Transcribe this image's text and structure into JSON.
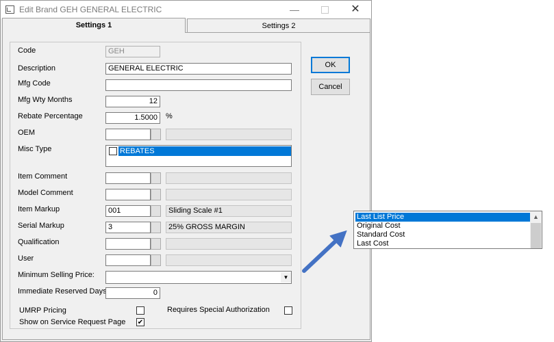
{
  "window": {
    "title": "Edit Brand GEH GENERAL ELECTRIC",
    "min_glyph": "—",
    "close_glyph": "✕"
  },
  "tabs": [
    {
      "label": "Settings 1",
      "active": true
    },
    {
      "label": "Settings 2",
      "active": false
    }
  ],
  "form": {
    "code": {
      "label": "Code",
      "value": "GEH"
    },
    "description": {
      "label": "Description",
      "value": "GENERAL ELECTRIC"
    },
    "mfg_code": {
      "label": "Mfg Code",
      "value": ""
    },
    "mfg_wty_months": {
      "label": "Mfg Wty Months",
      "value": "12"
    },
    "rebate_percentage": {
      "label": "Rebate Percentage",
      "value": "1.5000",
      "unit": "%"
    },
    "oem": {
      "label": "OEM",
      "value": "",
      "desc": ""
    },
    "misc_type": {
      "label": "Misc Type",
      "items": [
        {
          "label": "REBATES",
          "checked": false
        }
      ]
    },
    "item_comment": {
      "label": "Item Comment",
      "value": "",
      "desc": ""
    },
    "model_comment": {
      "label": "Model Comment",
      "value": "",
      "desc": ""
    },
    "item_markup": {
      "label": "Item Markup",
      "value": "001",
      "desc": "Sliding Scale #1"
    },
    "serial_markup": {
      "label": "Serial Markup",
      "value": "3",
      "desc": "25% GROSS MARGIN"
    },
    "qualification": {
      "label": "Qualification",
      "value": "",
      "desc": ""
    },
    "user": {
      "label": "User",
      "value": "",
      "desc": ""
    },
    "minimum_selling_price": {
      "label": "Minimum Selling Price:",
      "value": "",
      "dropdown_glyph": "▼"
    },
    "immediate_reserved_days": {
      "label": "Immediate Reserved Days",
      "value": "0"
    },
    "umrp_pricing": {
      "label": "UMRP Pricing",
      "checked": false
    },
    "requires_special_authorization": {
      "label": "Requires Special Authorization",
      "checked": false
    },
    "show_on_service_request_page": {
      "label": "Show on Service Request Page",
      "checked": true,
      "check_glyph": "✔"
    }
  },
  "buttons": {
    "ok": "OK",
    "cancel": "Cancel"
  },
  "dropdown_popup": {
    "options": [
      "Last List Price",
      "Original Cost",
      "Standard Cost",
      "Last Cost"
    ],
    "selected": "Last List Price",
    "scroll_up_glyph": "▲"
  },
  "colors": {
    "accent": "#0078d7",
    "arrow": "#4472c4"
  }
}
